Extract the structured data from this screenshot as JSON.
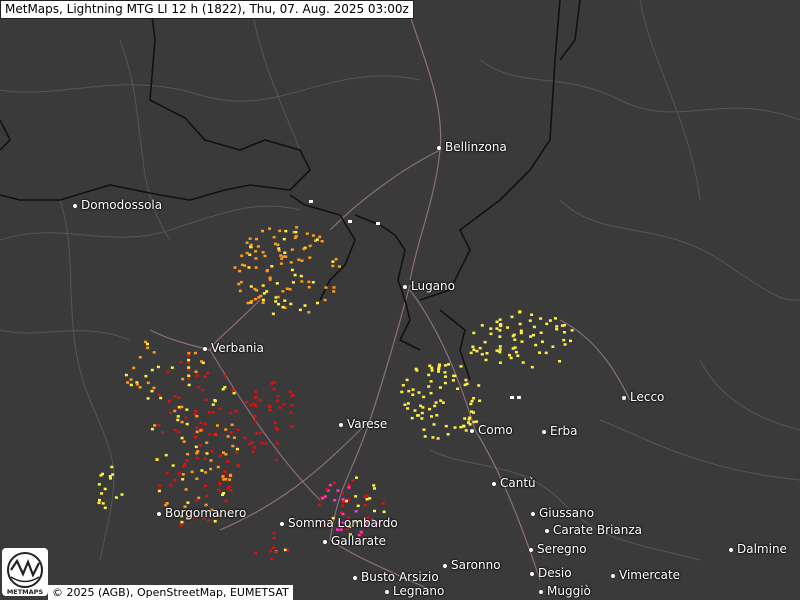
{
  "title": "MetMaps, Lightning MTG LI 12 h (1822), Thu, 07. Aug. 2025 03:00z",
  "attribution": "© 2025 (AGB), OpenStreetMap, EUMETSAT",
  "logo": {
    "text": "METMAPS",
    "icon": "metmaps-logo-icon"
  },
  "cities": [
    {
      "name": "Bellinzona"
    },
    {
      "name": "Domodossola"
    },
    {
      "name": "Lugano"
    },
    {
      "name": "Verbania"
    },
    {
      "name": "Lecco"
    },
    {
      "name": "Varese"
    },
    {
      "name": "Como"
    },
    {
      "name": "Erba"
    },
    {
      "name": "Cantù"
    },
    {
      "name": "Borgomanero"
    },
    {
      "name": "Somma Lombardo"
    },
    {
      "name": "Giussano"
    },
    {
      "name": "Carate Brianza"
    },
    {
      "name": "Gallarate"
    },
    {
      "name": "Seregno"
    },
    {
      "name": "Dalmine"
    },
    {
      "name": "Saronno"
    },
    {
      "name": "Busto Arsizio"
    },
    {
      "name": "Desio"
    },
    {
      "name": "Vimercate"
    },
    {
      "name": "Legnano"
    },
    {
      "name": "Muggiò"
    }
  ],
  "colors": {
    "background": "#3a3a3a",
    "border": "#111111",
    "road": "#8a6f78",
    "minor_line": "#565656",
    "stroke_recent": "#ffffff",
    "stroke_yellow": "#ffee44",
    "stroke_orange": "#ff9a1a",
    "stroke_red": "#e01010",
    "stroke_magenta": "#ff33cc"
  }
}
